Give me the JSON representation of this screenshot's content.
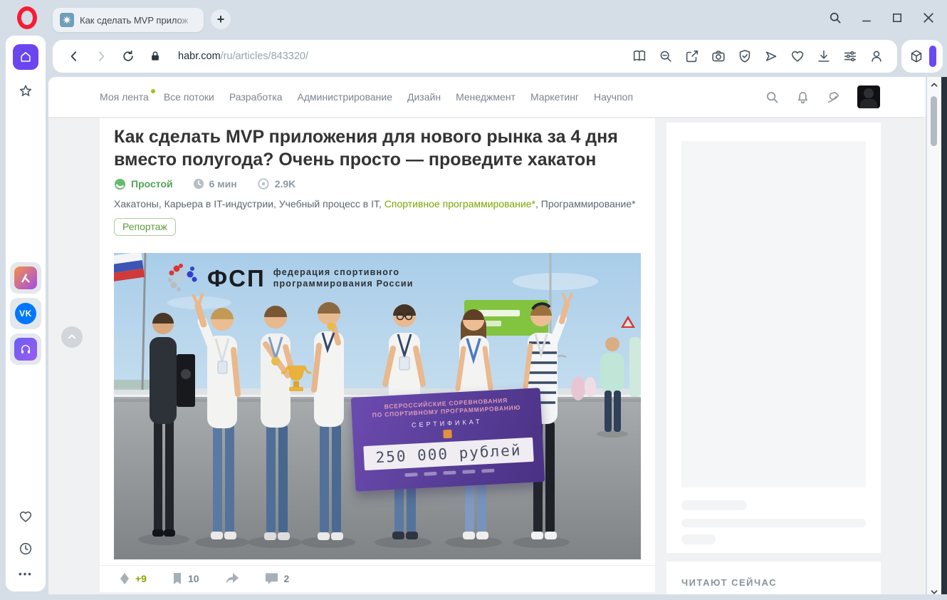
{
  "colors": {
    "accent_purple": "#6a48f5",
    "opera_red": "#f81c33",
    "hub_green": "#7aa600",
    "difficulty_green": "#53a457",
    "vk_blue": "#0077ff"
  },
  "window": {
    "controls": [
      "search",
      "minimize",
      "maximize",
      "close"
    ]
  },
  "browser": {
    "tab_title": "Как сделать MVP прилож",
    "new_tab_glyph": "+",
    "url_host": "habr.com",
    "url_path": "/ru/articles/843320/",
    "toolbar_icons": [
      "reader-mode",
      "zoom-out",
      "snapshot",
      "camera",
      "shield-check",
      "send-to-device",
      "favorites-heart",
      "downloads",
      "settings-sliders",
      "profile",
      "extension-cube"
    ],
    "vk_label": "VK"
  },
  "opera_sidebar": {
    "more_glyph": "•••",
    "icons": [
      "home",
      "bookmarks-star",
      "gradient-app",
      "vk",
      "music",
      "heart",
      "history-clock",
      "more-dots"
    ]
  },
  "habr": {
    "nav": {
      "items": [
        {
          "label": "Моя лента",
          "dot": true
        },
        {
          "label": "Все потоки"
        },
        {
          "label": "Разработка"
        },
        {
          "label": "Администрирование"
        },
        {
          "label": "Дизайн"
        },
        {
          "label": "Менеджмент"
        },
        {
          "label": "Маркетинг"
        },
        {
          "label": "Научпоп"
        }
      ]
    },
    "article": {
      "title": "Как сделать MVP приложения для нового рынка за 4 дня вместо полугода? Очень просто — проведите хакатон",
      "difficulty": "Простой",
      "read_time": "6 мин",
      "views": "2.9K",
      "hubs": [
        {
          "label": "Хакатоны",
          "sep": ", "
        },
        {
          "label": "Карьера в IT-индустрии",
          "sep": ", "
        },
        {
          "label": "Учебный процесс в IT",
          "sep": ", "
        },
        {
          "label": "Спортивное программирование*",
          "sep": ", ",
          "accent": true
        },
        {
          "label": "Программирование*",
          "sep": ""
        }
      ],
      "badge": "Репортаж",
      "stats": {
        "votes": "+9",
        "bookmarks": "10",
        "comments": "2"
      },
      "photo": {
        "fsp_abbr": "ФСП",
        "fsp_line1": "федерация спортивного",
        "fsp_line2": "программирования России",
        "cert_line1": "ВСЕРОССИЙСКИЕ СОРЕВНОВАНИЯ",
        "cert_line2": "ПО СПОРТИВНОМУ ПРОГРАММИРОВАНИЮ",
        "cert_label": "СЕРТИФИКАТ",
        "cert_amount": "250 000 рублей"
      }
    },
    "aside": {
      "reading_now": "ЧИТАЮТ СЕЙЧАС"
    }
  }
}
